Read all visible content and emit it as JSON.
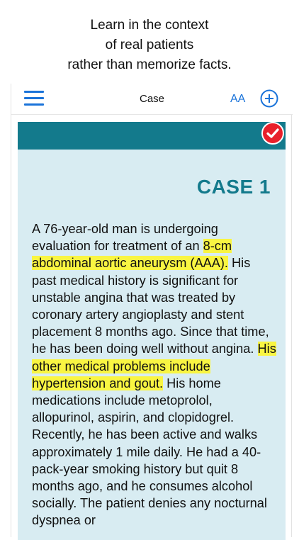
{
  "promo": {
    "lines": [
      "Learn in the context",
      "of real patients",
      "rather than memorize facts."
    ]
  },
  "navbar": {
    "title": "Case",
    "font_size_label": "AA"
  },
  "case": {
    "title": "CASE 1",
    "segments": [
      {
        "text": "A 76-year-old man is undergoing evaluation for treatment of an ",
        "highlight": false
      },
      {
        "text": "8-cm abdominal aortic aneurysm (AAA).",
        "highlight": true
      },
      {
        "text": " His past medical history is significant for unstable angina that was treated by coronary artery angioplasty and stent placement 8 months ago. Since that time, he has been doing well without angina. ",
        "highlight": false
      },
      {
        "text": "His other medical problems include hypertension and gout.",
        "highlight": true
      },
      {
        "text": " His home medications include metoprolol, allopurinol, aspirin, and clopidogrel. Recently, he has been active and walks approximately 1 mile daily. He had a 40-pack-year smoking history but quit 8 months ago, and he consumes alcohol socially. The patient denies any nocturnal dyspnea or",
        "highlight": false
      }
    ]
  },
  "colors": {
    "accent_blue": "#1a73d9",
    "teal": "#137a8c",
    "card_bg": "#d8ecf2",
    "highlight": "#f9f542",
    "check_red": "#e8202b"
  },
  "icons": {
    "menu": "hamburger-menu-icon",
    "add": "plus-circle-icon",
    "completed": "check-circle-icon"
  }
}
